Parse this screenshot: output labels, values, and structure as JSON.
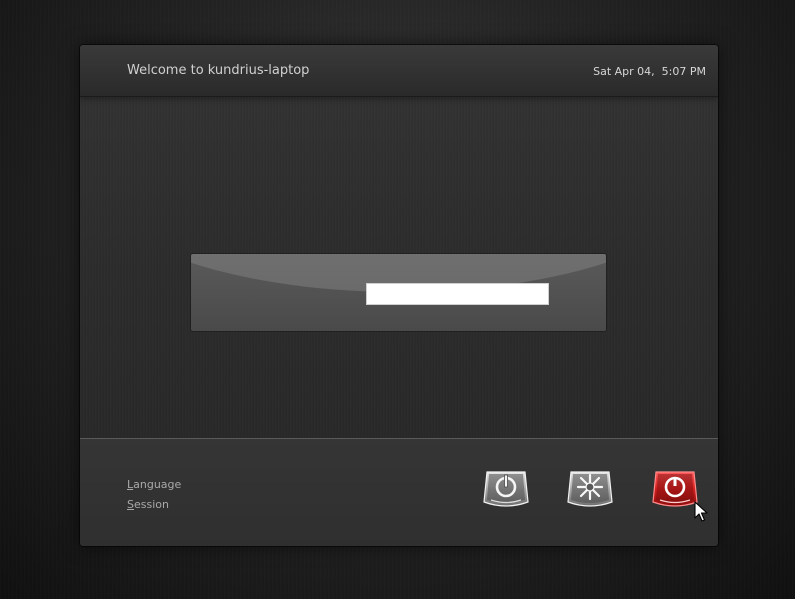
{
  "header": {
    "welcome_text": "Welcome to kundrius-laptop",
    "datetime": "Sat Apr 04,  5:07 PM"
  },
  "login": {
    "input_value": ""
  },
  "footer": {
    "language_accel": "L",
    "language_rest": "anguage",
    "session_accel": "S",
    "session_rest": "ession"
  },
  "actions": [
    {
      "icon": "standby-icon"
    },
    {
      "icon": "restart-icon"
    },
    {
      "icon": "shutdown-icon"
    }
  ],
  "colors": {
    "shutdown_accent": "#d42020",
    "link_text": "#a8a8a8"
  }
}
